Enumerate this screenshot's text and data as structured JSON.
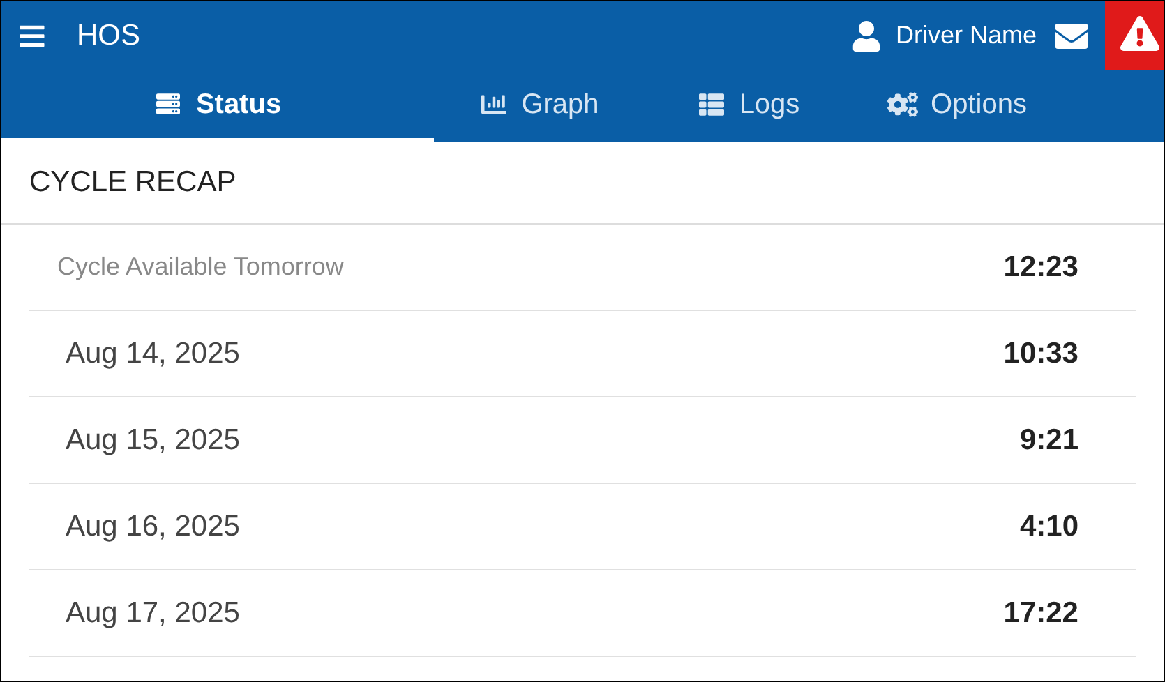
{
  "header": {
    "title": "HOS",
    "user_name": "Driver Name",
    "alert": true
  },
  "tabs": [
    {
      "label": "Status",
      "selected": true
    },
    {
      "label": "Graph",
      "selected": false
    },
    {
      "label": "Logs",
      "selected": false
    },
    {
      "label": "Options",
      "selected": false
    }
  ],
  "section": {
    "title": "CYCLE RECAP"
  },
  "rows": [
    {
      "kind": "note",
      "label": "Cycle Available Tomorrow",
      "value": "12:23"
    },
    {
      "kind": "date",
      "label": "Aug 14, 2025",
      "value": "10:33"
    },
    {
      "kind": "date",
      "label": "Aug 15, 2025",
      "value": "9:21"
    },
    {
      "kind": "date",
      "label": "Aug 16, 2025",
      "value": "4:10"
    },
    {
      "kind": "date",
      "label": "Aug 17, 2025",
      "value": "17:22"
    }
  ]
}
